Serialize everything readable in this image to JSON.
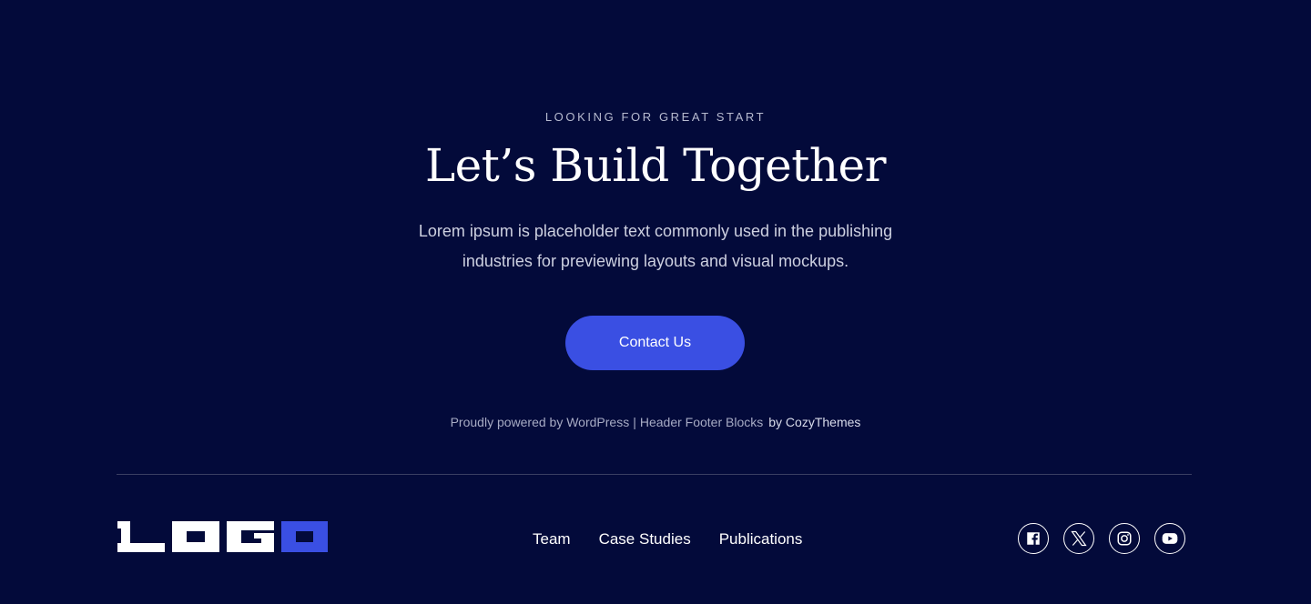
{
  "cta": {
    "eyebrow": "LOOKING FOR GREAT START",
    "headline": "Let’s Build Together",
    "lede": "Lorem ipsum is placeholder text commonly used in the publishing industries for previewing layouts and visual mockups.",
    "button_label": "Contact Us"
  },
  "credits": {
    "powered": "Proudly powered by WordPress",
    "separator": "|",
    "theme": "Header Footer Blocks",
    "author": "by CozyThemes"
  },
  "footer": {
    "logo_text": "LOGO",
    "nav": [
      {
        "label": "Team"
      },
      {
        "label": "Case Studies"
      },
      {
        "label": "Publications"
      }
    ],
    "socials": [
      {
        "icon": "facebook-icon"
      },
      {
        "icon": "x-icon"
      },
      {
        "icon": "instagram-icon"
      },
      {
        "icon": "youtube-icon"
      }
    ]
  },
  "colors": {
    "background": "#030a3a",
    "accent": "#3a4fe3",
    "text": "#ffffff"
  }
}
